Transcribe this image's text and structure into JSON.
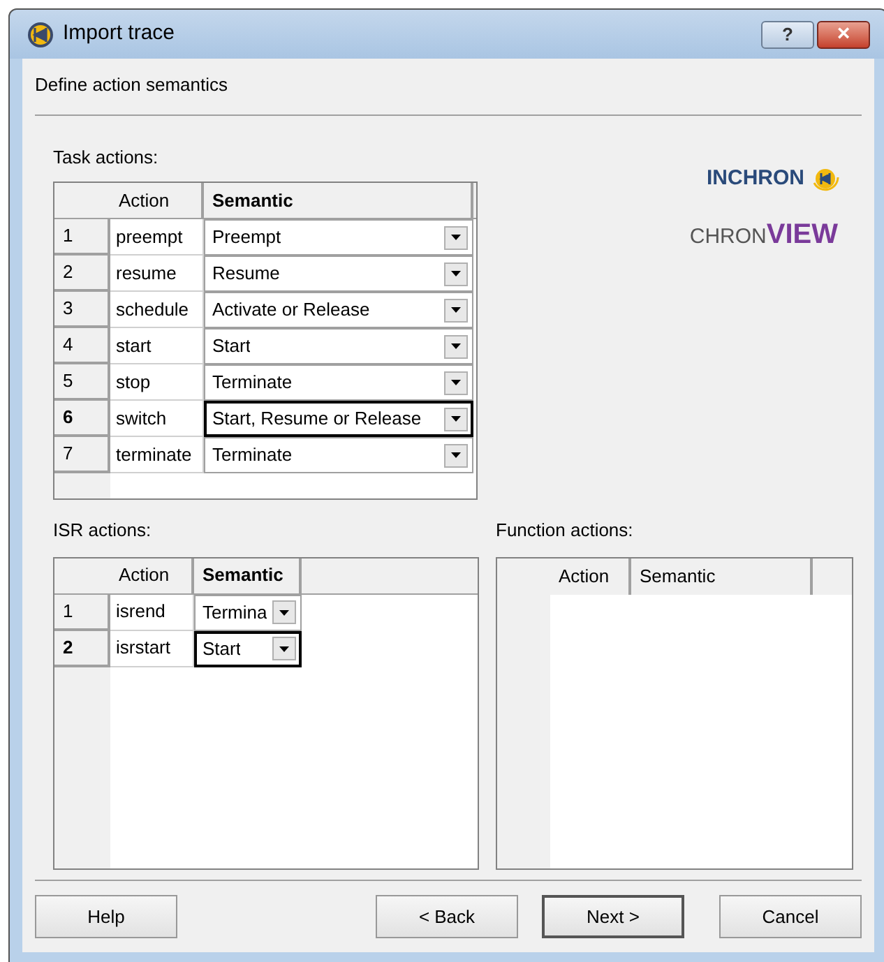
{
  "window": {
    "title": "Import trace",
    "buttons": [
      "?",
      "×"
    ]
  },
  "page_title": "Define action semantics",
  "logo": {
    "brand": "INCHRON",
    "product_first": "CHRON",
    "product_second": "VIEW"
  },
  "task_actions": {
    "label": "Task actions:",
    "columns": [
      {
        "label": "Action",
        "selected": false
      },
      {
        "label": "Semantic",
        "selected": true
      }
    ],
    "rows": [
      {
        "number": "1",
        "action": "preempt",
        "semantic": "Preempt",
        "selected": false
      },
      {
        "number": "2",
        "action": "resume",
        "semantic": "Resume",
        "selected": false
      },
      {
        "number": "3",
        "action": "schedule",
        "semantic": "Activate or Release",
        "selected": false
      },
      {
        "number": "4",
        "action": "start",
        "semantic": "Start",
        "selected": false
      },
      {
        "number": "5",
        "action": "stop",
        "semantic": "Terminate",
        "selected": false
      },
      {
        "number": "6",
        "action": "switch",
        "semantic": "Start, Resume or Release",
        "selected": true
      },
      {
        "number": "7",
        "action": "terminate",
        "semantic": "Terminate",
        "selected": false
      }
    ]
  },
  "isr_actions": {
    "label": "ISR actions:",
    "columns": [
      {
        "label": "Action",
        "selected": false
      },
      {
        "label": "Semantic",
        "selected": true
      }
    ],
    "rows": [
      {
        "number": "1",
        "action": "isrend",
        "semantic": "Termina",
        "selected": false
      },
      {
        "number": "2",
        "action": "isrstart",
        "semantic": "Start",
        "selected": true
      }
    ]
  },
  "function_actions": {
    "label": "Function actions:",
    "columns": [
      {
        "label": "Action",
        "selected": false
      },
      {
        "label": "Semantic",
        "selected": false
      }
    ]
  },
  "buttons": [
    {
      "label": "Help",
      "default": false
    },
    {
      "label": "< Back",
      "default": false
    },
    {
      "label": "Next >",
      "default": true
    },
    {
      "label": "Cancel",
      "default": false
    }
  ]
}
